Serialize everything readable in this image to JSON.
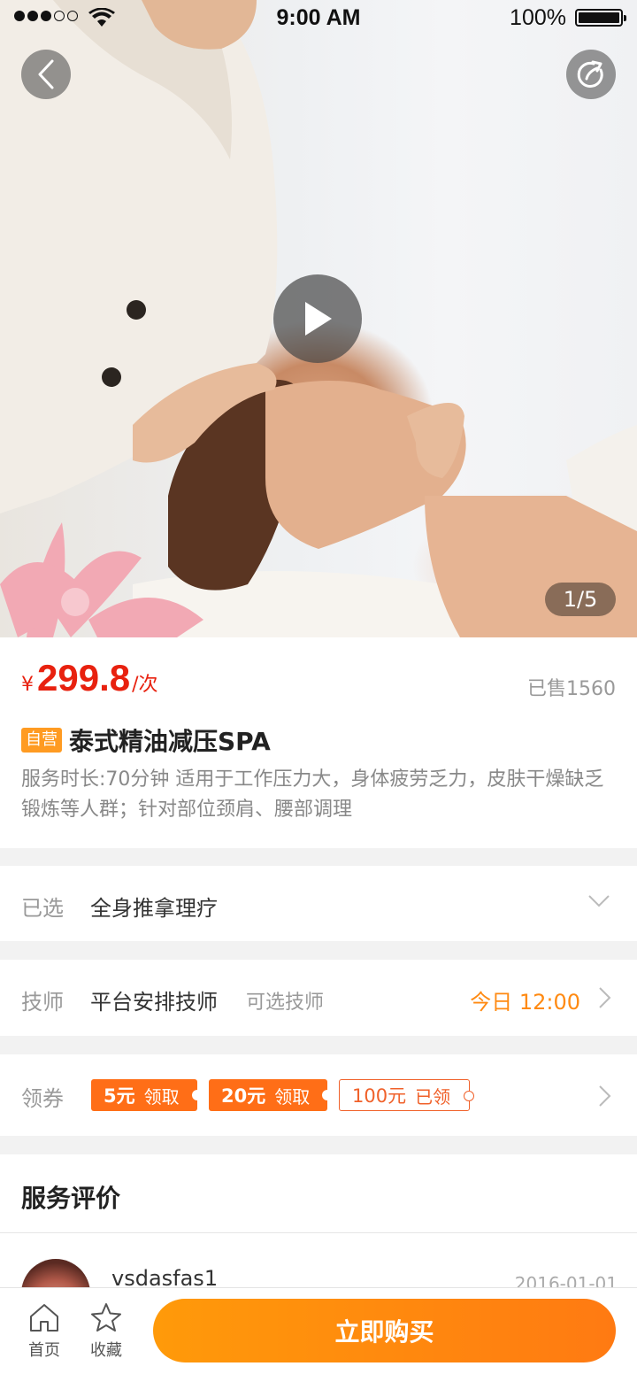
{
  "status_bar": {
    "time": "9:00 AM",
    "battery": "100%"
  },
  "hero": {
    "page_indicator": "1/5"
  },
  "product": {
    "currency": "¥",
    "price": "299.8",
    "unit": "/次",
    "sold": "已售1560",
    "badge": "自营",
    "title": "泰式精油减压SPA",
    "description": "服务时长:70分钟  适用于工作压力大，身体疲劳乏力，皮肤干燥缺乏锻炼等人群；针对部位颈肩、腰部调理"
  },
  "selected": {
    "label": "已选",
    "value": "全身推拿理疗"
  },
  "technician": {
    "label": "技师",
    "value": "平台安排技师",
    "option": "可选技师",
    "time": "今日 12:00"
  },
  "coupons": {
    "label": "领券",
    "items": [
      {
        "amount": "5元",
        "action": "领取"
      },
      {
        "amount": "20元",
        "action": "领取"
      },
      {
        "amount": "100元",
        "action": "已领"
      }
    ]
  },
  "reviews": {
    "title": "服务评价",
    "first": {
      "user": "vsdasfas1",
      "date": "2016-01-01"
    }
  },
  "bottom_bar": {
    "home": "首页",
    "favorite": "收藏",
    "buy": "立即购买"
  },
  "colors": {
    "price": "#e8210f",
    "accent": "#ff8a12",
    "badge": "#ff9b22",
    "coupon": "#ff6e17"
  }
}
